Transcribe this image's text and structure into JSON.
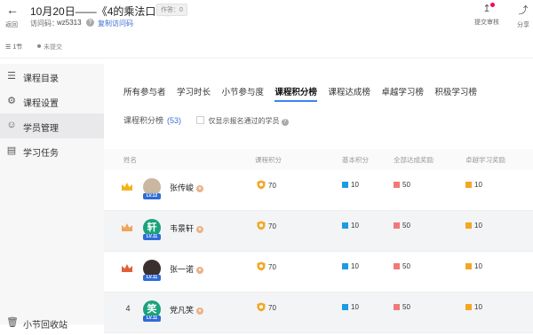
{
  "header": {
    "back_label": "返回",
    "title": "10月20日——《4的乘法口诀》",
    "answer_badge": "作答：0",
    "access_label": "访问码：",
    "access_code": "wz5313",
    "copy_link": "复制访问码",
    "submit_review_label": "提交审核",
    "share_label": "分享"
  },
  "subbar": {
    "section_count": "1节",
    "status": "未提交"
  },
  "sidebar": {
    "items": [
      {
        "label": "课程目录",
        "icon": "list-icon"
      },
      {
        "label": "课程设置",
        "icon": "gear-icon"
      },
      {
        "label": "学员管理",
        "icon": "user-icon",
        "active": true
      },
      {
        "label": "学习任务",
        "icon": "clipboard-icon"
      },
      {
        "label": "小节回收站",
        "icon": "trash-icon"
      }
    ]
  },
  "tabs": [
    "所有参与者",
    "学习时长",
    "小节参与度",
    "课程积分榜",
    "课程达成榜",
    "卓越学习榜",
    "积极学习榜"
  ],
  "active_tab": "课程积分榜",
  "filter": {
    "label": "课程积分榜",
    "count": "(53)",
    "checkbox_label": "仅显示报名通过的学员"
  },
  "table": {
    "headers": [
      "姓名",
      "课程积分",
      "基本积分",
      "全部达成奖励",
      "卓越学习奖励"
    ],
    "rows": [
      {
        "rank": "",
        "crown": "gold",
        "name": "张传峻",
        "level": "LV.12",
        "score": "70",
        "basic": "10",
        "all": "50",
        "excellent": "10",
        "avatar_color": "#c9b7a0",
        "avatar_text": ""
      },
      {
        "rank": "",
        "crown": "silver",
        "name": "韦景轩",
        "level": "LV.11",
        "score": "70",
        "basic": "10",
        "all": "50",
        "excellent": "10",
        "avatar_color": "#1aa37a",
        "avatar_text": "轩"
      },
      {
        "rank": "",
        "crown": "bronze",
        "name": "张一诺",
        "level": "LV.11",
        "score": "70",
        "basic": "10",
        "all": "50",
        "excellent": "10",
        "avatar_color": "#3a3030",
        "avatar_text": ""
      },
      {
        "rank": "4",
        "crown": "",
        "name": "党凡笑",
        "level": "LV.11",
        "score": "70",
        "basic": "10",
        "all": "50",
        "excellent": "10",
        "avatar_color": "#1aa37a",
        "avatar_text": "笑"
      }
    ]
  },
  "colors": {
    "accent": "#3b82f6",
    "basic": "#1e9be0",
    "all": "#f07a7a",
    "excellent": "#f5a623",
    "shield": "#f5a623"
  }
}
